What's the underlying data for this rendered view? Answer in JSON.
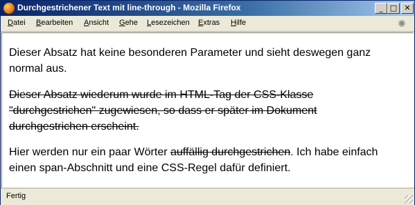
{
  "window": {
    "title": "Durchgestrichener Text mit line-through - Mozilla Firefox"
  },
  "menu": [
    {
      "label_mn": "D",
      "label_rest": "atei"
    },
    {
      "label_mn": "B",
      "label_rest": "earbeiten"
    },
    {
      "label_mn": "A",
      "label_rest": "nsicht"
    },
    {
      "label_mn": "G",
      "label_rest": "ehe"
    },
    {
      "label_mn": "L",
      "label_rest": "esezeichen"
    },
    {
      "label_mn": "E",
      "label_rest": "xtras"
    },
    {
      "label_mn": "H",
      "label_rest": "ilfe"
    }
  ],
  "content": {
    "para1": "Dieser Absatz hat keine besonderen Parameter und sieht deswegen ganz normal aus.",
    "para2": "Dieser Absatz wiederum wurde im HTML-Tag der CSS-Klasse \"durchgestrichen\" zugewiesen, so dass er später im Dokument durchgestrichen erscheint.",
    "para3_before": "Hier werden nur ein paar Wörter ",
    "para3_strike": "auffällig durchgestrichen",
    "para3_after": ". Ich habe einfach einen span-Abschnitt und eine CSS-Regel dafür definiert."
  },
  "status": {
    "text": "Fertig"
  }
}
